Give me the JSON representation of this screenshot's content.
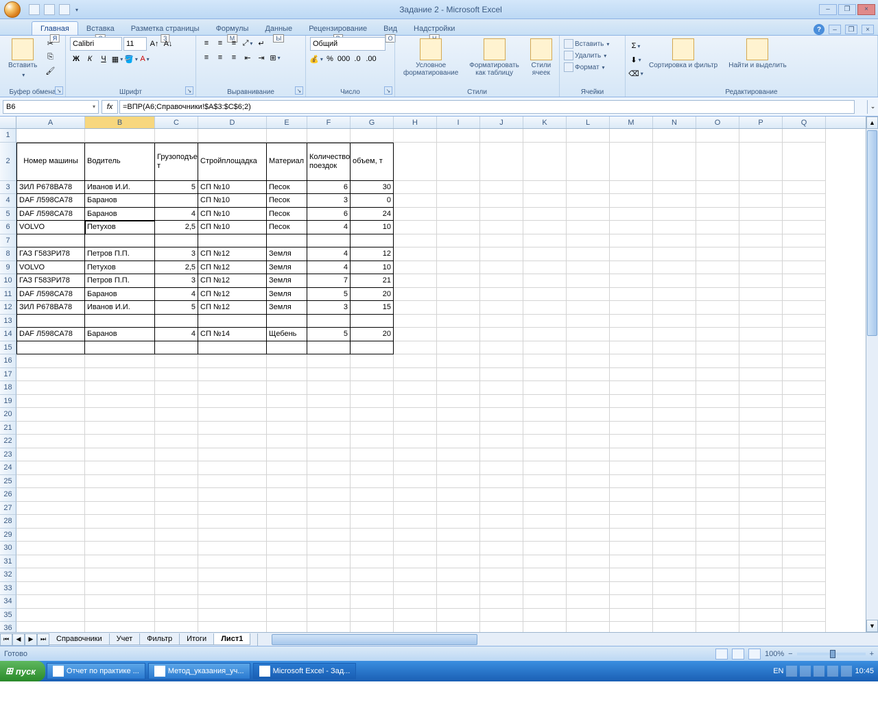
{
  "title": "Задание 2 - Microsoft Excel",
  "tabs": {
    "home": "Главная",
    "insert": "Вставка",
    "layout": "Разметка страницы",
    "formulas": "Формулы",
    "data": "Данные",
    "review": "Рецензирование",
    "view": "Вид",
    "addins": "Надстройки"
  },
  "tab_hints": {
    "home": "Я",
    "insert": "С",
    "layout": "З",
    "formulas": "М",
    "data": "Ы",
    "review": "Р",
    "view": "О",
    "addins": "Н"
  },
  "ribbon": {
    "paste": "Вставить",
    "clipboard": "Буфер обмена",
    "font": "Шрифт",
    "align": "Выравнивание",
    "number": "Число",
    "styles": "Стили",
    "cells": "Ячейки",
    "editing": "Редактирование",
    "font_name": "Calibri",
    "font_size": "11",
    "num_fmt": "Общий",
    "cond_fmt": "Условное форматирование",
    "fmt_table": "Форматировать как таблицу",
    "cell_styles": "Стили ячеек",
    "insert_btn": "Вставить",
    "delete_btn": "Удалить",
    "format_btn": "Формат",
    "sort": "Сортировка и фильтр",
    "find": "Найти и выделить",
    "bold": "Ж",
    "italic": "К",
    "underline": "Ч"
  },
  "name_box": "B6",
  "formula": "=ВПР(A6;Справочники!$A$3:$C$6;2)",
  "cols": [
    "A",
    "B",
    "C",
    "D",
    "E",
    "F",
    "G",
    "H",
    "I",
    "J",
    "K",
    "L",
    "M",
    "N",
    "O",
    "P",
    "Q"
  ],
  "headers": {
    "A": "Номер машины",
    "B": "Водитель",
    "C": "Грузоподъемность, т",
    "D": "Стройплощадка",
    "E": "Материал",
    "F": "Количество поездок",
    "G": "объем, т"
  },
  "rows": [
    {
      "n": 3,
      "A": "ЗИЛ Р678ВА78",
      "B": "Иванов И.И.",
      "C": "5",
      "D": "СП №10",
      "E": "Песок",
      "F": "6",
      "G": "30"
    },
    {
      "n": 4,
      "A": "DAF Л598СА78",
      "B": "Баранов",
      "C": "",
      "D": "СП №10",
      "E": "Песок",
      "F": "3",
      "G": "0"
    },
    {
      "n": 5,
      "A": "DAF Л598СА78",
      "B": "Баранов",
      "C": "4",
      "D": "СП №10",
      "E": "Песок",
      "F": "6",
      "G": "24"
    },
    {
      "n": 6,
      "A": "VOLVO",
      "B": "Петухов",
      "C": "2,5",
      "D": "СП №10",
      "E": "Песок",
      "F": "4",
      "G": "10"
    },
    {
      "n": 7,
      "A": "",
      "B": "",
      "C": "",
      "D": "",
      "E": "",
      "F": "",
      "G": ""
    },
    {
      "n": 8,
      "A": "ГАЗ Г583РИ78",
      "B": "Петров П.П.",
      "C": "3",
      "D": "СП №12",
      "E": "Земля",
      "F": "4",
      "G": "12"
    },
    {
      "n": 9,
      "A": "VOLVO",
      "B": "Петухов",
      "C": "2,5",
      "D": "СП №12",
      "E": "Земля",
      "F": "4",
      "G": "10"
    },
    {
      "n": 10,
      "A": "ГАЗ Г583РИ78",
      "B": "Петров П.П.",
      "C": "3",
      "D": "СП №12",
      "E": "Земля",
      "F": "7",
      "G": "21"
    },
    {
      "n": 11,
      "A": "DAF Л598СА78",
      "B": "Баранов",
      "C": "4",
      "D": "СП №12",
      "E": "Земля",
      "F": "5",
      "G": "20"
    },
    {
      "n": 12,
      "A": "ЗИЛ Р678ВА78",
      "B": "Иванов И.И.",
      "C": "5",
      "D": "СП №12",
      "E": "Земля",
      "F": "3",
      "G": "15"
    },
    {
      "n": 13,
      "A": "",
      "B": "",
      "C": "",
      "D": "",
      "E": "",
      "F": "",
      "G": ""
    },
    {
      "n": 14,
      "A": "DAF Л598СА78",
      "B": "Баранов",
      "C": "4",
      "D": "СП №14",
      "E": "Щебень",
      "F": "5",
      "G": "20"
    },
    {
      "n": 15,
      "A": "",
      "B": "",
      "C": "",
      "D": "",
      "E": "",
      "F": "",
      "G": ""
    }
  ],
  "sheets": [
    "Справочники",
    "Учет",
    "Фильтр",
    "Итоги",
    "Лист1"
  ],
  "active_sheet": "Лист1",
  "status": "Готово",
  "zoom": "100%",
  "lang": "EN",
  "clock": "10:45",
  "taskbar": {
    "start": "пуск",
    "t1": "Отчет по практике ...",
    "t2": "Метод_указания_уч...",
    "t3": "Microsoft Excel - Зад..."
  }
}
